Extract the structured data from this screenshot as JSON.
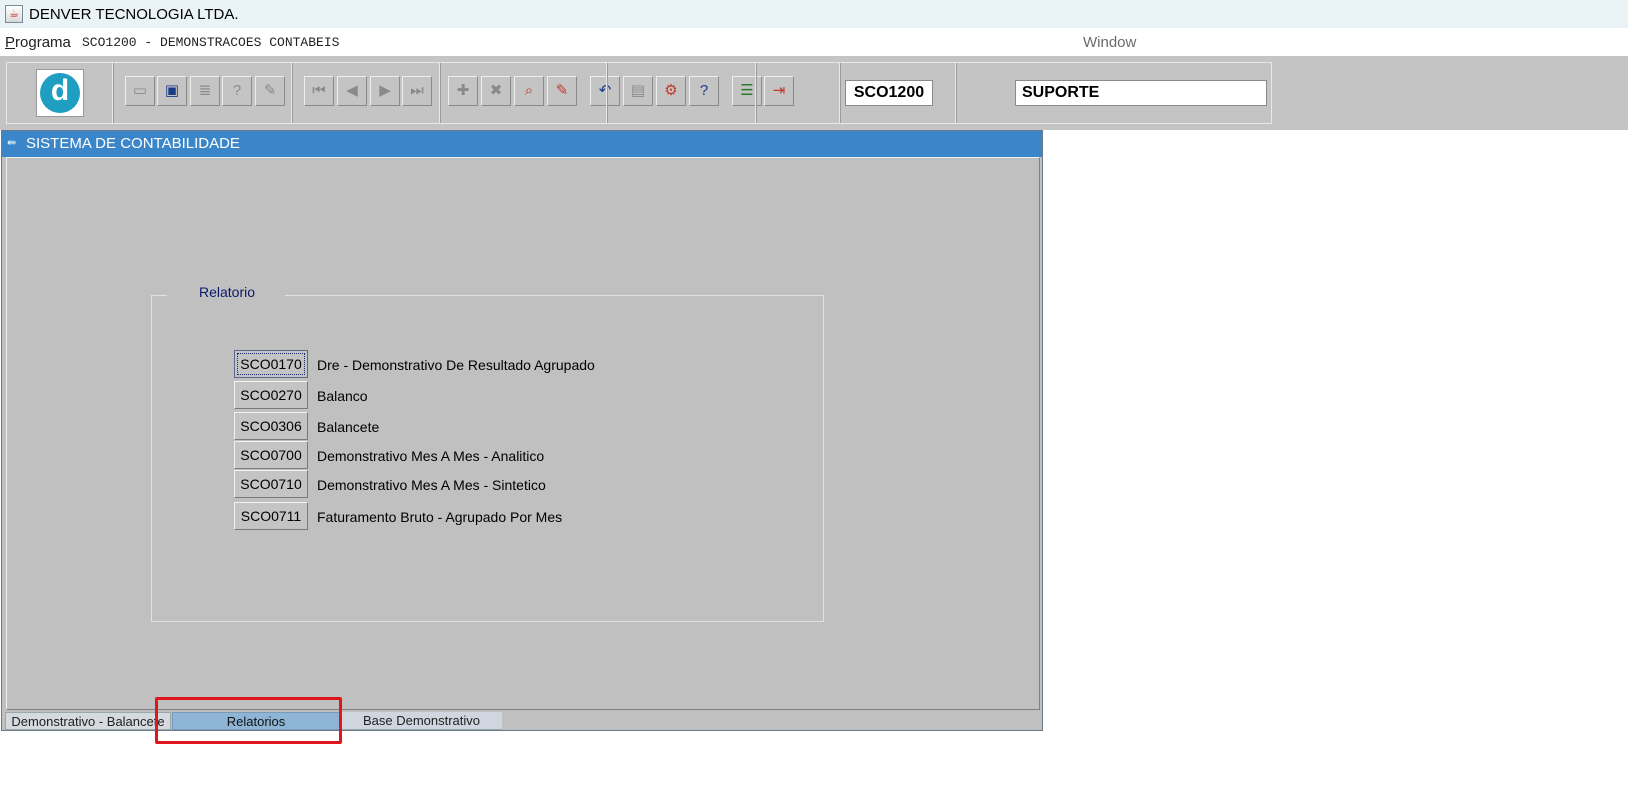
{
  "window": {
    "title": "DENVER TECNOLOGIA LTDA."
  },
  "menubar": {
    "programa_label": "rograma",
    "programa_accel": "P",
    "program_title": "SCO1200 - DEMONSTRACOES CONTABEIS",
    "window_menu": "Window"
  },
  "toolbar": {
    "buttons": [
      {
        "icon": "save-icon",
        "glyph": "▭"
      },
      {
        "icon": "screen-icon",
        "glyph": "▣"
      },
      {
        "icon": "print-icon",
        "glyph": "≣"
      },
      {
        "icon": "query-help-icon",
        "glyph": "?"
      },
      {
        "icon": "edit-icon",
        "glyph": "✎"
      },
      {
        "icon": "first-record-icon",
        "glyph": "⏮"
      },
      {
        "icon": "prev-record-icon",
        "glyph": "◀"
      },
      {
        "icon": "next-record-icon",
        "glyph": "▶"
      },
      {
        "icon": "last-record-icon",
        "glyph": "⏭"
      },
      {
        "icon": "insert-icon",
        "glyph": "✚"
      },
      {
        "icon": "delete-icon",
        "glyph": "✖"
      },
      {
        "icon": "query-icon",
        "glyph": "⌕"
      },
      {
        "icon": "clear-icon",
        "glyph": "✎"
      },
      {
        "icon": "undo-icon",
        "glyph": "↶"
      },
      {
        "icon": "clipboard-icon",
        "glyph": "▤"
      },
      {
        "icon": "tools-icon",
        "glyph": "⚙"
      },
      {
        "icon": "help-icon",
        "glyph": "?"
      },
      {
        "icon": "menu-icon",
        "glyph": "☰"
      },
      {
        "icon": "exit-icon",
        "glyph": "⇥"
      }
    ],
    "program_code": "SCO1200",
    "user": "SUPORTE"
  },
  "main": {
    "title": "SISTEMA DE CONTABILIDADE",
    "frame_title": "Relatorio",
    "reports": [
      {
        "code": "SCO0170",
        "label": "Dre - Demonstrativo De Resultado Agrupado"
      },
      {
        "code": "SCO0270",
        "label": "Balanco"
      },
      {
        "code": "SCO0306",
        "label": "Balancete"
      },
      {
        "code": "SCO0700",
        "label": "Demonstrativo Mes A Mes - Analitico"
      },
      {
        "code": "SCO0710",
        "label": "Demonstrativo Mes A Mes - Sintetico"
      },
      {
        "code": "SCO0711",
        "label": "Faturamento Bruto  - Agrupado Por Mes"
      }
    ],
    "tabs": [
      "Demonstrativo - Balancete",
      "Relatorios",
      "Base Demonstrativo"
    ],
    "active_tab": "Relatorios"
  },
  "colors": {
    "titlebar": "#3b86c8",
    "active_tab": "#8fb5d6",
    "highlight": "#e0161e",
    "logo": "#1e9ec1"
  }
}
